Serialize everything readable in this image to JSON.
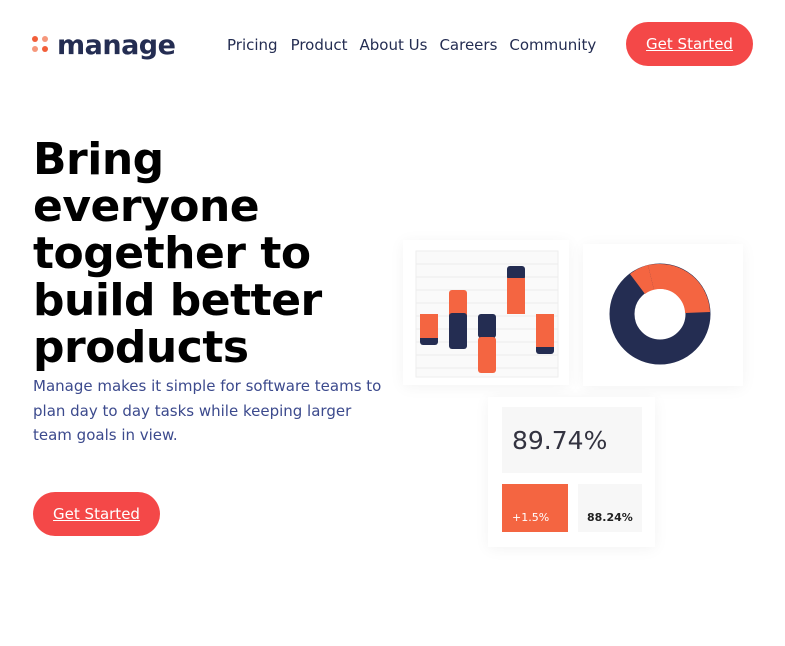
{
  "header": {
    "logo_text": "manage",
    "nav": [
      "Pricing",
      "Product",
      "About Us",
      "Careers",
      "Community"
    ],
    "cta_label": "Get Started"
  },
  "hero": {
    "title_lines": [
      "Bring everyone",
      "together to",
      "build better",
      "products"
    ],
    "description": "Manage makes it simple for software teams to plan day to day tasks while keeping larger team goals in view.",
    "cta_label": "Get Started"
  },
  "stats": {
    "main_value": "89.74%",
    "change_value": "+1.5%",
    "secondary_value": "88.24%"
  },
  "colors": {
    "accent": "#f44848",
    "orange": "#f46541",
    "navy": "#242d52",
    "text_blue": "#3c4a8d"
  },
  "illustration": {
    "bars": [
      {
        "navy": 0.2,
        "orange": 0.8
      },
      {
        "navy": 0.6,
        "orange": 0.4
      },
      {
        "navy": 0.3,
        "orange": 0.7
      },
      {
        "navy": 0.2,
        "orange": 0.8
      },
      {
        "navy": 0.2,
        "orange": 0.8
      }
    ],
    "donut": {
      "orange_fraction": 0.32,
      "navy_fraction": 0.68
    }
  }
}
